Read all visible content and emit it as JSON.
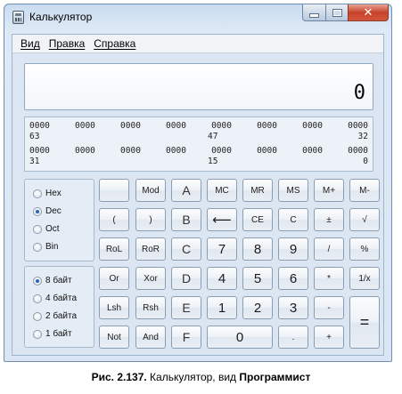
{
  "window": {
    "title": "Калькулятор",
    "close_glyph": "✕"
  },
  "menu": [
    "Вид",
    "Правка",
    "Справка"
  ],
  "display": {
    "value": "0"
  },
  "bits": {
    "row1": [
      "0000",
      "0000",
      "0000",
      "0000",
      "0000",
      "0000",
      "0000",
      "0000"
    ],
    "row1_labels": [
      "63",
      "47",
      "32"
    ],
    "row2": [
      "0000",
      "0000",
      "0000",
      "0000",
      "0000",
      "0000",
      "0000",
      "0000"
    ],
    "row2_labels": [
      "31",
      "15",
      "0"
    ]
  },
  "base_options": [
    {
      "label": "Hex",
      "selected": false
    },
    {
      "label": "Dec",
      "selected": true
    },
    {
      "label": "Oct",
      "selected": false
    },
    {
      "label": "Bin",
      "selected": false
    }
  ],
  "word_options": [
    {
      "label": "8 байт",
      "selected": true
    },
    {
      "label": "4 байта",
      "selected": false
    },
    {
      "label": "2 байта",
      "selected": false
    },
    {
      "label": "1 байт",
      "selected": false
    }
  ],
  "keys": {
    "blank": "",
    "mod": "Mod",
    "A": "A",
    "MC": "MC",
    "MR": "MR",
    "MS": "MS",
    "Mplus": "M+",
    "Mminus": "M-",
    "lparen": "(",
    "rparen": ")",
    "B": "B",
    "back": "⟵",
    "CE": "CE",
    "C": "C",
    "plusminus": "±",
    "sqrt": "√",
    "RoL": "RoL",
    "RoR": "RoR",
    "Ck": "C",
    "d7": "7",
    "d8": "8",
    "d9": "9",
    "div": "/",
    "pct": "%",
    "Or": "Or",
    "Xor": "Xor",
    "D": "D",
    "d4": "4",
    "d5": "5",
    "d6": "6",
    "mul": "*",
    "recip": "1/x",
    "Lsh": "Lsh",
    "Rsh": "Rsh",
    "E": "E",
    "d1": "1",
    "d2": "2",
    "d3": "3",
    "minus": "-",
    "eq": "=",
    "Not": "Not",
    "And": "And",
    "F": "F",
    "d0": "0",
    "dot": ".",
    "plus": "+"
  },
  "caption": {
    "prefix": "Рис. 2.137.",
    "text": " Калькулятор, вид ",
    "bold": "Программист"
  }
}
